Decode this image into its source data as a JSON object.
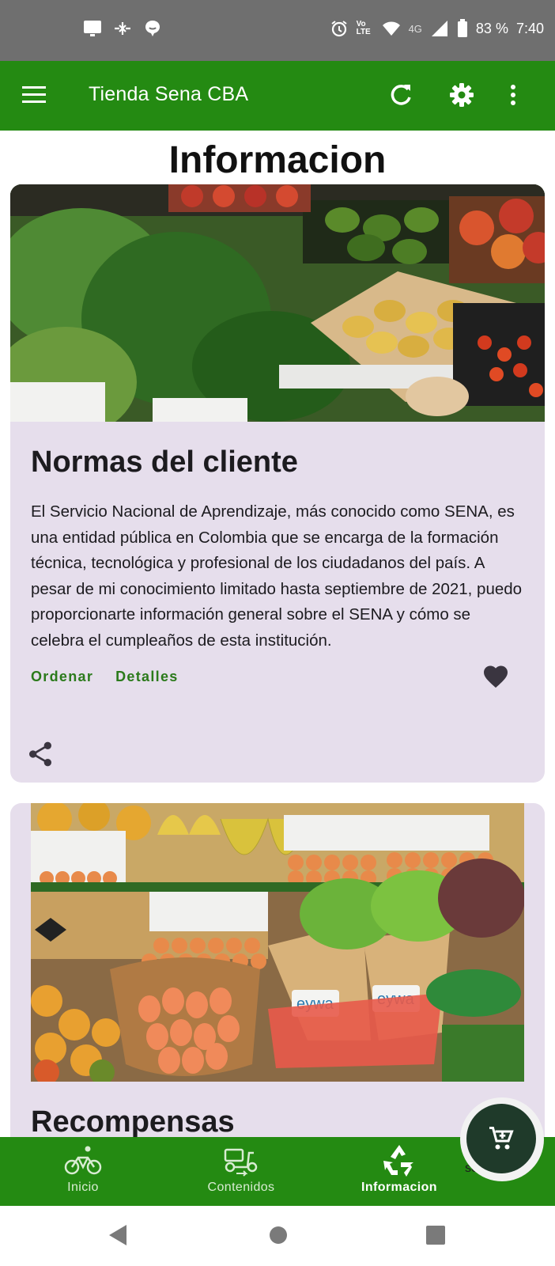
{
  "status_bar": {
    "battery": "83 %",
    "time": "7:40",
    "network": "4G",
    "volte": "Vo LTE",
    "icons": [
      "screen-icon",
      "signal-spark-icon",
      "chat-bubble-icon",
      "alarm-icon",
      "wifi-icon",
      "cell-signal-icon",
      "battery-icon"
    ]
  },
  "app_bar": {
    "title": "Tienda Sena CBA",
    "actions": [
      "refresh-icon",
      "settings-icon",
      "more-vert-icon"
    ],
    "background": "#248a12"
  },
  "page": {
    "title": "Informacion"
  },
  "cards": [
    {
      "image": "vegetable-market-photo",
      "title": "Normas del cliente",
      "body": "El Servicio Nacional de Aprendizaje, más conocido como SENA, es una entidad pública en Colombia que se encarga de la formación técnica, tecnológica y profesional de los ciudadanos del país. A pesar de mi conocimiento limitado hasta septiembre de 2021, puedo proporcionarte información general sobre el SENA y cómo se celebra el cumpleaños de esta institución.",
      "actions": [
        "Ordenar",
        "Detalles"
      ]
    },
    {
      "image": "eggs-and-produce-photo",
      "image_text": [
        "eywa",
        "eywa"
      ],
      "title": "Recompensas"
    }
  ],
  "bottom_nav": {
    "items": [
      {
        "label": "Inicio",
        "icon": "bicycle-icon",
        "active": false
      },
      {
        "label": "Contenidos",
        "icon": "delivery-scooter-icon",
        "active": false
      },
      {
        "label": "Informacion",
        "icon": "recycle-icon",
        "active": true
      }
    ],
    "overflow_text": "sencia"
  },
  "fab": {
    "icon": "cart-icon"
  },
  "colors": {
    "accent": "#248a12",
    "card_bg": "#e6deec",
    "text_button": "#2b7a1b",
    "fab_bg": "#1f3a2a"
  }
}
